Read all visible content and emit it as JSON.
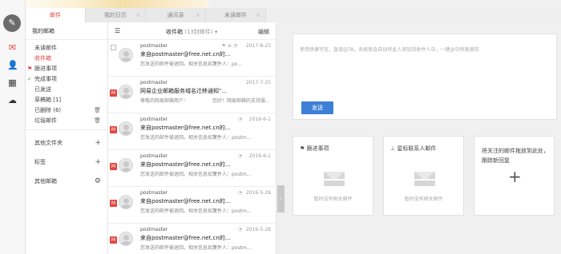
{
  "tabs": [
    {
      "label": "邮件",
      "close": ""
    },
    {
      "label": "我的日历",
      "close": "×"
    },
    {
      "label": "通讯录",
      "close": "×"
    },
    {
      "label": "未读邮件",
      "close": "×"
    }
  ],
  "folders": {
    "header": "我的邮箱",
    "items": [
      {
        "label": "未读邮件"
      },
      {
        "label": "收件箱"
      },
      {
        "label": "跟进事项"
      },
      {
        "label": "完成事项"
      },
      {
        "label": "已发送"
      },
      {
        "label": "草稿箱 [1]"
      },
      {
        "label": "已删除 (6)"
      },
      {
        "label": "垃圾邮件"
      }
    ],
    "sections": [
      {
        "label": "其他文件夹",
        "action": "+"
      },
      {
        "label": "标签",
        "action": "+"
      },
      {
        "label": "其他邮箱",
        "action": "⚙"
      }
    ]
  },
  "list": {
    "menu_icon": "☰",
    "title": "收件箱",
    "subtitle": "(13封邮件) ▾",
    "edit": "编辑",
    "rows": [
      {
        "sender": "postmaster",
        "subject": "来自postmaster@free.net.cn的...",
        "preview": "您发送的邮件被退回。相关信息如下：",
        "preview2": "发件人：po...",
        "date": "2017-8-23",
        "meta": "⚑ ⊕ ◔"
      },
      {
        "sender": "postmaster",
        "subject": "网易企业邮箱服务域名迁移通知\"...",
        "preview": "尊敬的网易邮箱用户：",
        "preview2": "您好！网易邮箱的支持服...",
        "date": "2017-7-25",
        "meta": ""
      },
      {
        "sender": "postmaster",
        "subject": "来自postmaster@free.net.cn的...",
        "preview": "您发送的邮件被退回。相关信息如下：",
        "preview2": "发件人：postm...",
        "date": "2016-6-1",
        "meta": "◔"
      },
      {
        "sender": "postmaster",
        "subject": "来自postmaster@free.net.cn的...",
        "preview": "您发送的邮件被退回。相关信息如下：",
        "preview2": "发件人：postm...",
        "date": "2016-6-1",
        "meta": "◔"
      },
      {
        "sender": "postmaster",
        "subject": "来自postmaster@free.net.cn的...",
        "preview": "您发送的邮件被退回。相关信息如下：",
        "preview2": "发件人：postm...",
        "date": "2016-5-28",
        "meta": "◔"
      },
      {
        "sender": "postmaster",
        "subject": "来自postmaster@free.net.cn的...",
        "preview": "您发送的邮件被退回。相关信息如下：",
        "preview2": "发件人：postm...",
        "date": "2016-5-28",
        "meta": "◔"
      }
    ]
  },
  "compose": {
    "placeholder": "使用快捷写信，直接@TA，系统就会自动将此人添加到收件人中，一键@中快速速回",
    "send": "发送"
  },
  "cards": [
    {
      "title": "⚑ 跟进事项",
      "empty": "暂时没有相关邮件"
    },
    {
      "title": "⊥ 星标联系人邮件",
      "empty": "暂时没有相关邮件"
    },
    {
      "title": "将关注的邮件拖放到此处，跟踪新回复",
      "plus": "+"
    }
  ],
  "colors": {
    "accent": "#e2463f",
    "send_button": "#3d7fd6"
  }
}
